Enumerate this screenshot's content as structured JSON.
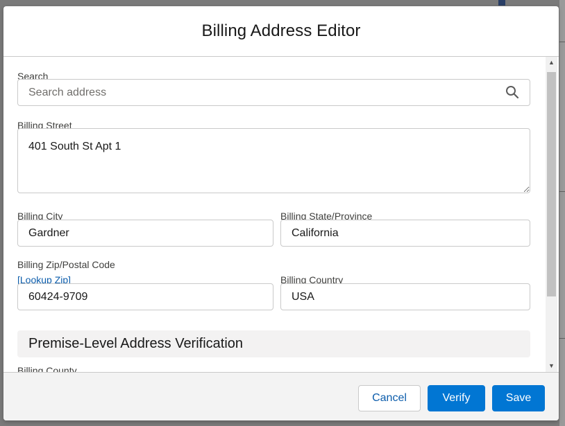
{
  "modal": {
    "title": "Billing Address Editor"
  },
  "form": {
    "search_label": "Search",
    "search_placeholder": "Search address",
    "street_label": "Billing Street",
    "street_value": "401 South St Apt 1",
    "city_label": "Billing City",
    "city_value": "Gardner",
    "state_label": "Billing State/Province",
    "state_value": "California",
    "zip_label": "Billing Zip/Postal Code",
    "lookup_zip_link": "[Lookup Zip]",
    "zip_value": "60424-9709",
    "country_label": "Billing Country",
    "country_value": "USA",
    "section_title": "Premise-Level Address Verification",
    "county_label": "Billing County"
  },
  "footer": {
    "cancel_label": "Cancel",
    "verify_label": "Verify",
    "save_label": "Save"
  },
  "colors": {
    "brand": "#0176d3",
    "link": "#0b5cab",
    "section_bg": "#f3f2f2"
  },
  "icons": {
    "search": "search-icon",
    "scroll_up": "scroll-up-arrow",
    "scroll_down": "scroll-down-arrow"
  }
}
